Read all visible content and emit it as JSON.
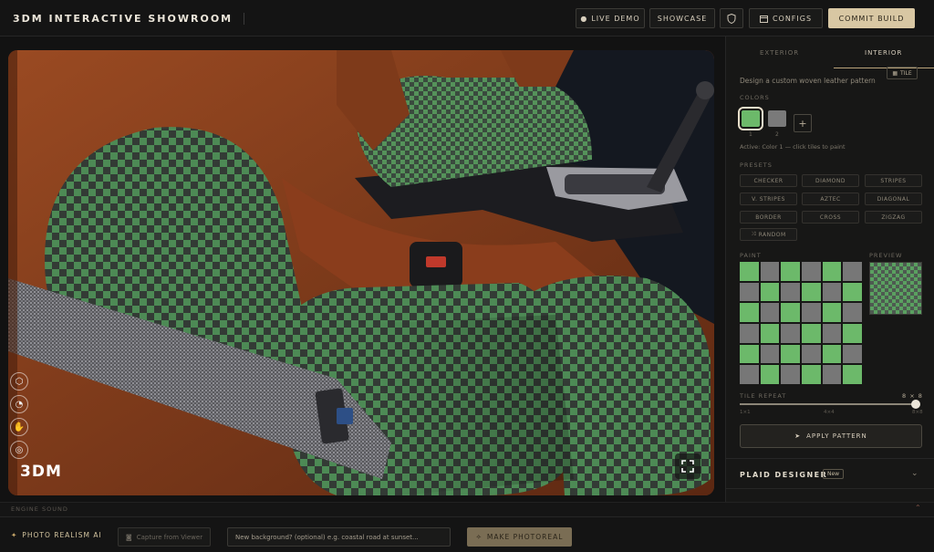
{
  "header": {
    "title": "3DM INTERACTIVE SHOWROOM",
    "live_demo": "LIVE DEMO",
    "showcase": "SHOWCASE",
    "configs": "CONFIGS",
    "commit_build": "COMMIT BUILD"
  },
  "viewer": {
    "logo": "3DM",
    "side_icons": [
      "tree-icon",
      "seat-icon",
      "hand-icon",
      "steering-icon"
    ]
  },
  "panel": {
    "tabs": [
      {
        "label": "EXTERIOR",
        "active": false
      },
      {
        "label": "INTERIOR",
        "active": true
      }
    ],
    "subtitle": "Design a custom woven leather pattern",
    "tile_chip": "TILE",
    "colors_label": "COLORS",
    "colors": [
      {
        "number": "1",
        "hex": "#6cb96a",
        "active": true
      },
      {
        "number": "2",
        "hex": "#7a7a7a",
        "active": false
      }
    ],
    "active_note": "Active: Color 1 — click tiles to paint",
    "presets_label": "PRESETS",
    "presets": [
      "CHECKER",
      "DIAMOND",
      "STRIPES",
      "V. STRIPES",
      "AZTEC",
      "DIAGONAL",
      "BORDER",
      "CROSS",
      "ZIGZAG",
      "RANDOM"
    ],
    "paint_label": "PAINT",
    "preview_label": "PREVIEW",
    "tile_repeat_label": "TILE REPEAT",
    "tile_repeat_value": "8 × 8",
    "tile_repeat_level": 1.0,
    "tile_repeat_ticks": [
      "1×1",
      "4×4",
      "8×8"
    ],
    "apply_label": "APPLY PATTERN",
    "plaid_title": "PLAID DESIGNER",
    "plaid_badge": "New"
  },
  "engine": {
    "label": "ENGINE SOUND"
  },
  "bottom": {
    "photo_realism": "PHOTO REALISM AI",
    "capture": "Capture from Viewer",
    "bg_placeholder": "New background? (optional) e.g. coastal road at sunset...",
    "make": "MAKE PHOTOREAL"
  },
  "colors": {
    "accent_gold": "#d8c7a3",
    "weave_green": "#6cb96a",
    "weave_grey": "#7a7a7a",
    "leather": "#8a3f1c"
  }
}
